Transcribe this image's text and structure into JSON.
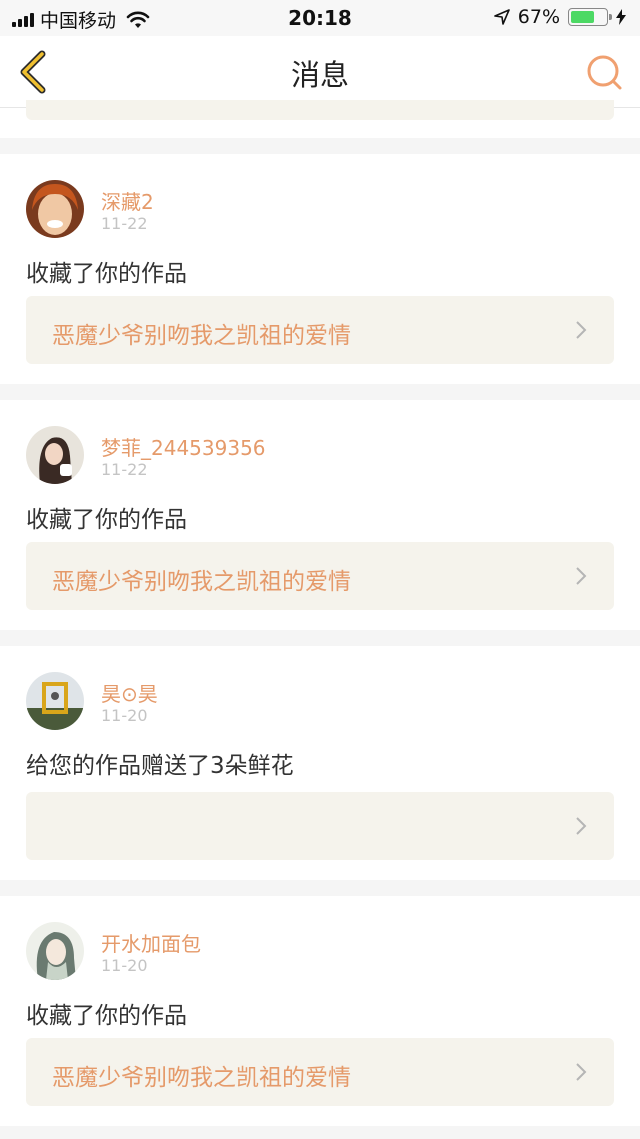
{
  "status_bar": {
    "carrier": "中国移动",
    "time": "20:18",
    "battery": "67%",
    "battery_level": 0.67
  },
  "nav": {
    "title": "消息"
  },
  "messages": [
    {
      "username": "深藏2",
      "date": "11-22",
      "action": "收藏了你的作品",
      "work_title": "恶魔少爷别吻我之凯祖的爱情"
    },
    {
      "username": "梦菲_244539356",
      "date": "11-22",
      "action": "收藏了你的作品",
      "work_title": "恶魔少爷别吻我之凯祖的爱情"
    },
    {
      "username": "昊⊙昊",
      "date": "11-20",
      "action": "给您的作品赠送了3朵鲜花",
      "work_title": ""
    },
    {
      "username": "开水加面包",
      "date": "11-20",
      "action": "收藏了你的作品",
      "work_title": "恶魔少爷别吻我之凯祖的爱情"
    }
  ],
  "colors": {
    "accent": "#e59a6a",
    "back_arrow": "#f0c030",
    "box_bg": "#f5f3ec"
  },
  "icons": [
    "back-arrow-icon",
    "search-icon",
    "chevron-right-icon",
    "wifi-icon",
    "location-icon",
    "charging-icon"
  ]
}
